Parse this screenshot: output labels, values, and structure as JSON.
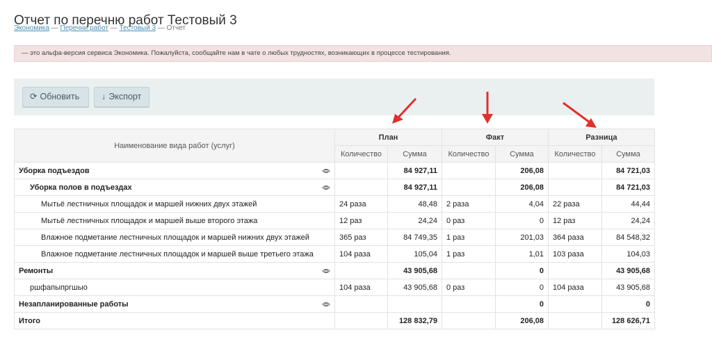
{
  "page": {
    "title": "Отчет по перечню работ Тестовый 3",
    "breadcrumb": [
      {
        "label": "Экономика"
      },
      {
        "label": "Перечни работ"
      },
      {
        "label": "Тестовый 3"
      },
      {
        "label": "Отчет"
      }
    ],
    "breadcrumb_sep": "—",
    "alert": "— это альфа-версия сервиса Экономика. Пожалуйста, сообщайте нам в чате о любых трудностях, возникающих в процессе тестирования."
  },
  "toolbar": {
    "refresh_label": "Обновить",
    "refresh_icon": "⟳",
    "export_label": "Экспорт",
    "export_icon": "↓"
  },
  "table": {
    "name_header": "Наименование вида работ (услуг)",
    "groups": [
      "План",
      "Факт",
      "Разница"
    ],
    "sub_qty": "Количество",
    "sub_sum": "Сумма",
    "rows": [
      {
        "name": "Уборка подъездов",
        "level": 0,
        "bold": true,
        "eye": true,
        "plan_qty": "",
        "plan_sum": "84 927,11",
        "fact_qty": "",
        "fact_sum": "206,08",
        "diff_qty": "",
        "diff_sum": "84 721,03"
      },
      {
        "name": "Уборка полов в подъездах",
        "level": 1,
        "bold": true,
        "eye": true,
        "plan_qty": "",
        "plan_sum": "84 927,11",
        "fact_qty": "",
        "fact_sum": "206,08",
        "diff_qty": "",
        "diff_sum": "84 721,03"
      },
      {
        "name": "Мытьё лестничных площадок и маршей нижних двух этажей",
        "level": 2,
        "bold": false,
        "eye": false,
        "plan_qty": "24 раза",
        "plan_sum": "48,48",
        "fact_qty": "2 раза",
        "fact_sum": "4,04",
        "diff_qty": "22 раза",
        "diff_sum": "44,44"
      },
      {
        "name": "Мытьё лестничных площадок и маршей выше второго этажа",
        "level": 2,
        "bold": false,
        "eye": false,
        "plan_qty": "12 раз",
        "plan_sum": "24,24",
        "fact_qty": "0 раз",
        "fact_sum": "0",
        "diff_qty": "12 раз",
        "diff_sum": "24,24"
      },
      {
        "name": "Влажное подметание лестничных площадок и маршей нижних двух этажей",
        "level": 2,
        "bold": false,
        "eye": false,
        "plan_qty": "365 раз",
        "plan_sum": "84 749,35",
        "fact_qty": "1 раз",
        "fact_sum": "201,03",
        "diff_qty": "364 раза",
        "diff_sum": "84 548,32"
      },
      {
        "name": "Влажное подметание лестничных площадок и маршей выше третьего этажа",
        "level": 2,
        "bold": false,
        "eye": false,
        "plan_qty": "104 раза",
        "plan_sum": "105,04",
        "fact_qty": "1 раз",
        "fact_sum": "1,01",
        "diff_qty": "103 раза",
        "diff_sum": "104,03"
      },
      {
        "name": "Ремонты",
        "level": 0,
        "bold": true,
        "eye": true,
        "plan_qty": "",
        "plan_sum": "43 905,68",
        "fact_qty": "",
        "fact_sum": "0",
        "diff_qty": "",
        "diff_sum": "43 905,68"
      },
      {
        "name": "ршфапыпргшыо",
        "level": 1,
        "bold": false,
        "eye": false,
        "plan_qty": "104 раза",
        "plan_sum": "43 905,68",
        "fact_qty": "0 раз",
        "fact_sum": "0",
        "diff_qty": "104 раза",
        "diff_sum": "43 905,68"
      },
      {
        "name": "Незапланированные работы",
        "level": 0,
        "bold": true,
        "eye": true,
        "plan_qty": "",
        "plan_sum": "",
        "fact_qty": "",
        "fact_sum": "0",
        "diff_qty": "",
        "diff_sum": "0"
      },
      {
        "name": "Итого",
        "level": 0,
        "bold": true,
        "eye": false,
        "plan_qty": "",
        "plan_sum": "128 832,79",
        "fact_qty": "",
        "fact_sum": "206,08",
        "diff_qty": "",
        "diff_sum": "128 626,71"
      }
    ]
  },
  "colors": {
    "link": "#4a8fb3",
    "alert_bg": "#f3e2e2",
    "toolbar_bg": "#eaeff0",
    "arrow": "#e0302a"
  }
}
